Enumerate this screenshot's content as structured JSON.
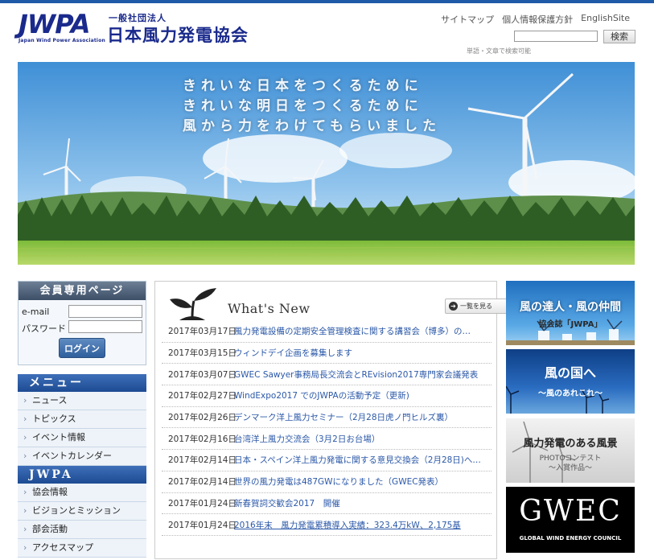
{
  "header": {
    "logo_mark": "JWPA",
    "logo_sub": "Japan Wind Power Association",
    "logo_corp": "一般社団法人",
    "logo_name": "日本風力発電協会",
    "links": [
      "サイトマップ",
      "個人情報保護方針",
      "EnglishSite"
    ],
    "search_button": "検索",
    "search_note": "単語・文章で検索可能"
  },
  "hero": {
    "lines": [
      "きれいな日本をつくるために",
      "きれいな明日をつくるために",
      "風から力をわけてもらいました"
    ]
  },
  "member": {
    "title": "会員専用ページ",
    "email_label": "e-mail",
    "password_label": "パスワード",
    "login_button": "ログイン"
  },
  "menu": {
    "head": "メニュー",
    "items": [
      "ニュース",
      "トピックス",
      "イベント情報",
      "イベントカレンダー"
    ],
    "head2": "JWPA",
    "items2": [
      "協会情報",
      "ビジョンとミッション",
      "部会活動",
      "アクセスマップ"
    ]
  },
  "news": {
    "title": "What's New",
    "more": "一覧を見る",
    "rows": [
      {
        "date": "2017年03月17日",
        "text": "風力発電設備の定期安全管理検査に関する講習会（博多）の…"
      },
      {
        "date": "2017年03月15日",
        "text": "ウィンドデイ企画を募集します"
      },
      {
        "date": "2017年03月07日",
        "text": "GWEC Sawyer事務局長交流会とREvision2017専門家会議発表"
      },
      {
        "date": "2017年02月27日",
        "text": "WindExpo2017 でのJWPAの活動予定（更新)"
      },
      {
        "date": "2017年02月26日",
        "text": "デンマーク洋上風力セミナー（2月28日虎ノ門ヒルズ裏）"
      },
      {
        "date": "2017年02月16日",
        "text": "台湾洋上風力交流会（3月2日お台場）"
      },
      {
        "date": "2017年02月14日",
        "text": "日本・スペイン洋上風力発電に関する意見交換会（2月28日)へ…"
      },
      {
        "date": "2017年02月14日",
        "text": "世界の風力発電は487GWになりました（GWEC発表）"
      },
      {
        "date": "2017年01月24日",
        "text": "新春賀詞交歓会2017　開催"
      },
      {
        "date": "2017年01月24日",
        "text": "2016年末　風力発電累積導入実績：323.4万kW、2,175基"
      }
    ]
  },
  "banners": {
    "b1_title": "風の達人・風の仲間",
    "b1_sub": "協会誌「JWPA」",
    "b2_title": "風の国へ",
    "b2_sub": "〜風のあれこれ〜",
    "b3_title": "風力発電のある風景",
    "b3_sub1": "PHOTOコンテスト",
    "b3_sub2": "〜入賞作品〜",
    "b4_title": "GWEC",
    "b4_sub": "GLOBAL WIND ENERGY COUNCIL"
  }
}
